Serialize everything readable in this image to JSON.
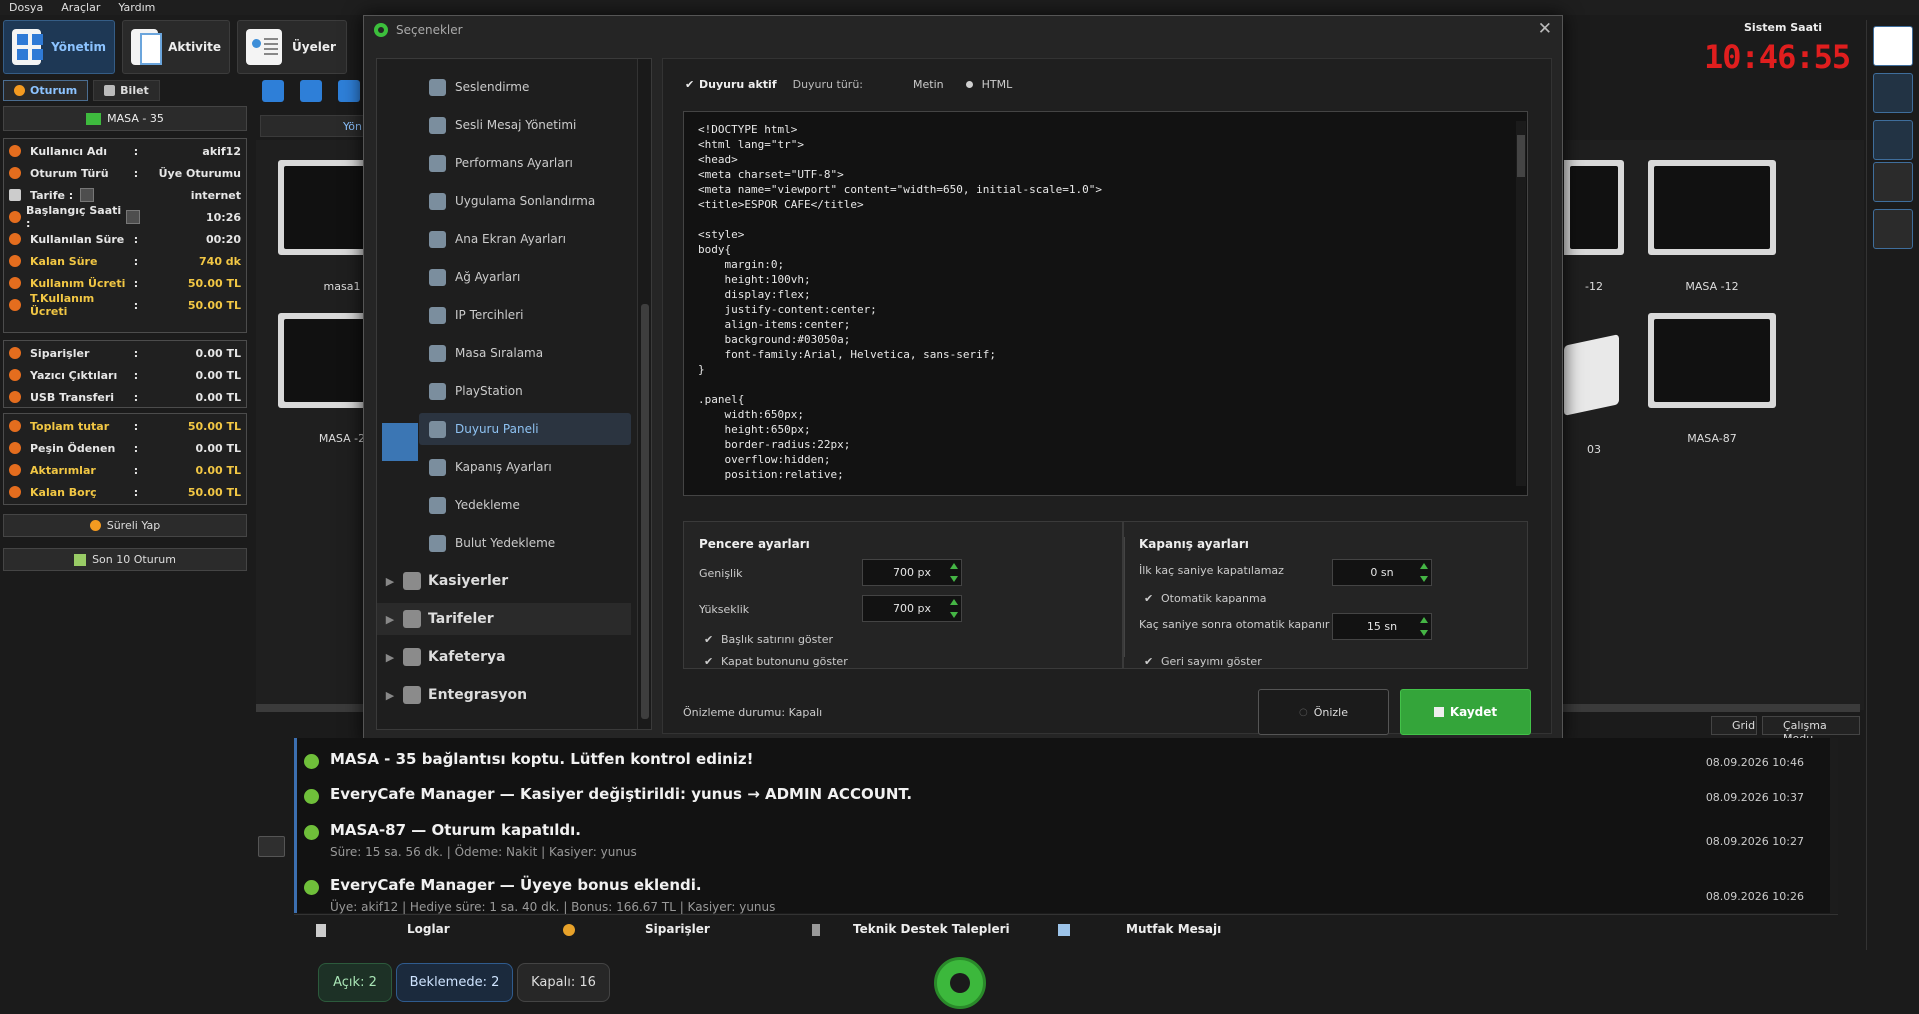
{
  "menu": [
    "Dosya",
    "Araçlar",
    "Yardım"
  ],
  "toolbar": {
    "yonetim": "Yönetim",
    "aktivite": "Aktivite",
    "uyeler": "Üyeler"
  },
  "left_tabs": {
    "oturum": "Oturum",
    "bilet": "Bilet"
  },
  "masa_header": "MASA - 35",
  "session": [
    {
      "label": "Kullanıcı Adı",
      "value": "akif12",
      "yellow": false
    },
    {
      "label": "Oturum Türü",
      "value": "Üye Oturumu",
      "yellow": false
    }
  ],
  "tarife": {
    "label": "Tarife :",
    "value": "internet"
  },
  "baslangic": {
    "label": "Başlangıç Saati :",
    "value": "10:26"
  },
  "times": [
    {
      "label": "Kullanılan Süre",
      "value": "00:20",
      "yellow": false
    },
    {
      "label": "Kalan Süre",
      "value": "740 dk",
      "yellow": true
    },
    {
      "label": "Kullanım Ücreti",
      "value": "50.00 TL",
      "yellow": true
    },
    {
      "label": "T.Kullanım Ücreti",
      "value": "50.00 TL",
      "yellow": true
    }
  ],
  "extras": [
    {
      "label": "Siparişler",
      "value": "0.00 TL",
      "yellow": false
    },
    {
      "label": "Yazıcı Çıktıları",
      "value": "0.00 TL",
      "yellow": false
    },
    {
      "label": "USB Transferi",
      "value": "0.00 TL",
      "yellow": false
    }
  ],
  "totals": [
    {
      "label": "Toplam tutar",
      "value": "50.00 TL",
      "yellow": true
    },
    {
      "label": "Peşin Ödenen",
      "value": "0.00 TL",
      "yellow": false
    },
    {
      "label": "Aktarımlar",
      "value": "0.00 TL",
      "yellow": true
    },
    {
      "label": "Kalan Borç",
      "value": "50.00 TL",
      "yellow": true
    }
  ],
  "sureli_yap": "Süreli Yap",
  "son10": "Son 10 Oturum",
  "inner_tab": "Yön",
  "monitors": [
    {
      "label": "masa1"
    },
    {
      "label": "MASA -2"
    },
    {
      "label": "-12"
    },
    {
      "label": "MASA -12"
    },
    {
      "label": "03"
    },
    {
      "label": "MASA-87"
    }
  ],
  "view": {
    "grid": "Grid",
    "mode": "Çalışma Modu"
  },
  "clock": {
    "title": "Sistem Saati",
    "time": "10:46:55"
  },
  "dialog": {
    "title": "Seçenekler",
    "nav_items": [
      "Seslendirme",
      "Sesli Mesaj Yönetimi",
      "Performans Ayarları",
      "Uygulama Sonlandırma",
      "Ana Ekran Ayarları",
      "Ağ Ayarları",
      "IP Tercihleri",
      "Masa Sıralama",
      "PlayStation",
      "Duyuru Paneli",
      "Kapanış Ayarları",
      "Yedekleme",
      "Bulut Yedekleme"
    ],
    "nav_groups": [
      "Kasiyerler",
      "Tarifeler",
      "Kafeterya",
      "Entegrasyon"
    ],
    "duyuru_aktif": "Duyuru aktif",
    "duyuru_turu": "Duyuru türü:",
    "metin": "Metin",
    "html": "HTML",
    "code": "<!DOCTYPE html>\n<html lang=\"tr\">\n<head>\n<meta charset=\"UTF-8\">\n<meta name=\"viewport\" content=\"width=650, initial-scale=1.0\">\n<title>ESPOR CAFE</title>\n\n<style>\nbody{\n    margin:0;\n    height:100vh;\n    display:flex;\n    justify-content:center;\n    align-items:center;\n    background:#03050a;\n    font-family:Arial, Helvetica, sans-serif;\n}\n\n.panel{\n    width:650px;\n    height:650px;\n    border-radius:22px;\n    overflow:hidden;\n    position:relative;",
    "pencere": {
      "title": "Pencere ayarları",
      "genislik": "Genişlik",
      "genislik_val": "700 px",
      "yukseklik": "Yükseklik",
      "yukseklik_val": "700 px",
      "baslik": "Başlık satırını göster",
      "kapat": "Kapat butonunu göster"
    },
    "kapanis": {
      "title": "Kapanış ayarları",
      "ilk": "İlk kaç saniye kapatılamaz",
      "ilk_val": "0 sn",
      "otomatik": "Otomatik kapanma",
      "kac": "Kaç saniye sonra otomatik kapanır",
      "kac_val": "15 sn",
      "geri": "Geri sayımı göster"
    },
    "onizleme_durumu": "Önizleme durumu: Kapalı",
    "onizle": "Önizle",
    "kaydet": "Kaydet"
  },
  "logs": [
    {
      "title": "MASA - 35 bağlantısı koptu. Lütfen kontrol ediniz!",
      "sub": "",
      "date": "08.09.2026 10:46"
    },
    {
      "title": "EveryCafe Manager — Kasiyer değiştirildi: yunus → ADMIN ACCOUNT.",
      "sub": "",
      "date": "08.09.2026 10:37"
    },
    {
      "title": "MASA-87 — Oturum kapatıldı.",
      "sub": "Süre: 15 sa. 56 dk. | Ödeme: Nakit | Kasiyer: yunus",
      "date": "08.09.2026 10:27"
    },
    {
      "title": "EveryCafe Manager — Üyeye bonus eklendi.",
      "sub": "Üye: akif12 | Hediye süre: 1 sa. 40 dk. | Bonus: 166.67 TL | Kasiyer: yunus",
      "date": "08.09.2026 10:26"
    }
  ],
  "bottom_tabs": [
    "Loglar",
    "Siparişler",
    "Teknik Destek Talepleri",
    "Mutfak Mesajı"
  ],
  "status": {
    "acik": "Açık: 2",
    "beklemede": "Beklemede: 2",
    "kapali": "Kapalı: 16"
  }
}
